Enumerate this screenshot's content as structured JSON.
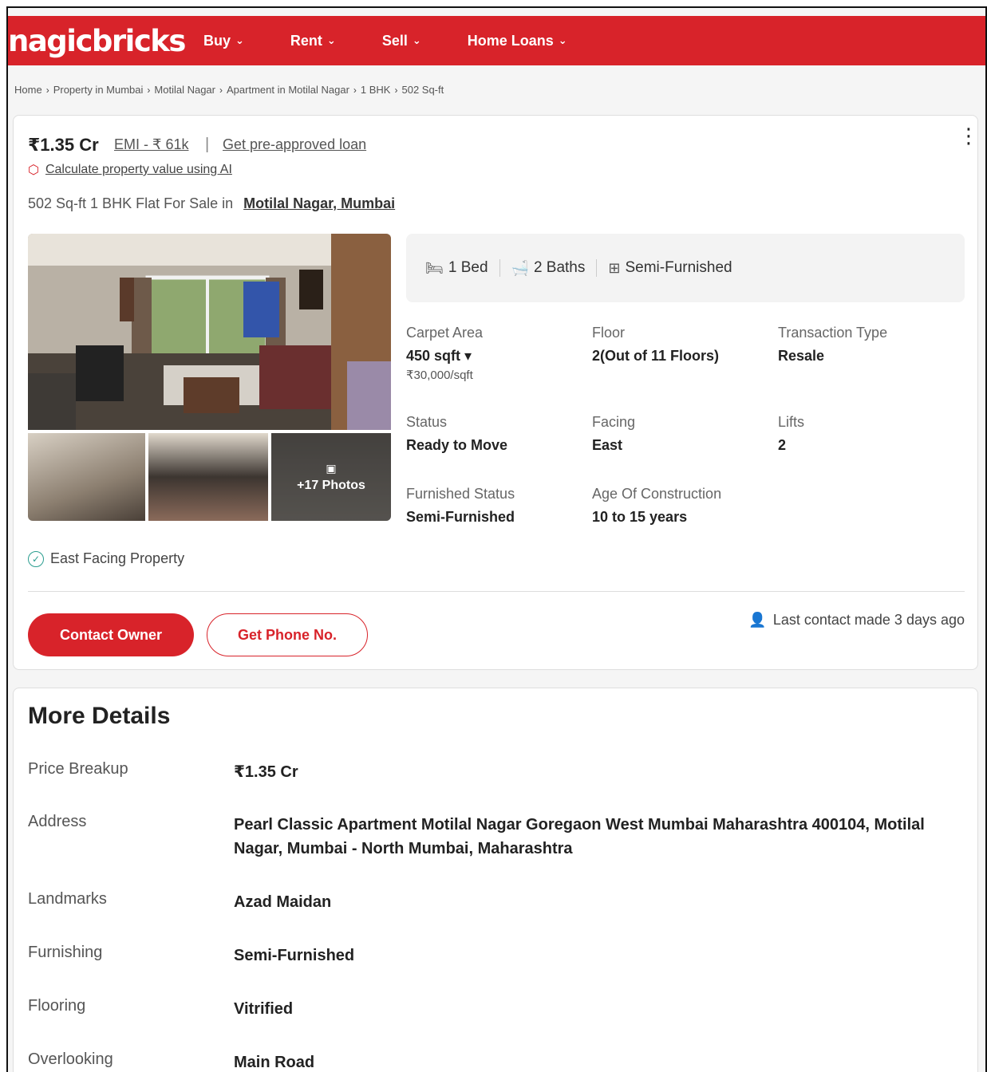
{
  "header": {
    "logo": "nagicbricks",
    "nav": [
      {
        "label": "Buy"
      },
      {
        "label": "Rent"
      },
      {
        "label": "Sell"
      },
      {
        "label": "Home Loans"
      }
    ]
  },
  "breadcrumb": [
    "Home",
    "Property in Mumbai",
    "Motilal Nagar",
    "Apartment in Motilal Nagar",
    "1 BHK",
    "502 Sq-ft"
  ],
  "listing": {
    "price": "₹1.35 Cr",
    "emi": "EMI - ₹ 61k",
    "separator": "|",
    "preapproved": "Get pre-approved loan",
    "ai_link": "Calculate property value using AI",
    "title_prefix": "502 Sq-ft 1 BHK Flat For Sale in",
    "location": "Motilal Nagar, Mumbai",
    "photos_more": "+17 Photos",
    "amenities": {
      "bed": "1 Bed",
      "bath": "2 Baths",
      "furnish": "Semi-Furnished"
    },
    "specs": {
      "carpet_label": "Carpet Area",
      "carpet_value": "450 sqft ▾",
      "carpet_rate": "₹30,000/sqft",
      "floor_label": "Floor",
      "floor_value": "2(Out of 11 Floors)",
      "transaction_label": "Transaction Type",
      "transaction_value": "Resale",
      "status_label": "Status",
      "status_value": "Ready to Move",
      "facing_label": "Facing",
      "facing_value": "East",
      "lifts_label": "Lifts",
      "lifts_value": "2",
      "furnished_label": "Furnished Status",
      "furnished_value": "Semi-Furnished",
      "age_label": "Age Of Construction",
      "age_value": "10 to 15 years"
    },
    "feature": "East Facing Property",
    "contact_owner": "Contact Owner",
    "get_phone": "Get Phone No.",
    "last_contact": "Last contact made 3 days ago"
  },
  "more_details": {
    "title": "More Details",
    "rows": [
      {
        "key": "Price Breakup",
        "value": "₹1.35 Cr"
      },
      {
        "key": "Address",
        "value": "Pearl Classic Apartment Motilal Nagar Goregaon West Mumbai Maharashtra 400104, Motilal Nagar, Mumbai - North Mumbai, Maharashtra"
      },
      {
        "key": "Landmarks",
        "value": "Azad Maidan"
      },
      {
        "key": "Furnishing",
        "value": "Semi-Furnished"
      },
      {
        "key": "Flooring",
        "value": "Vitrified"
      },
      {
        "key": "Overlooking",
        "value": "Main Road"
      }
    ]
  },
  "colors": {
    "brand": "#d8232a",
    "accent_green": "#2a9d8f"
  }
}
